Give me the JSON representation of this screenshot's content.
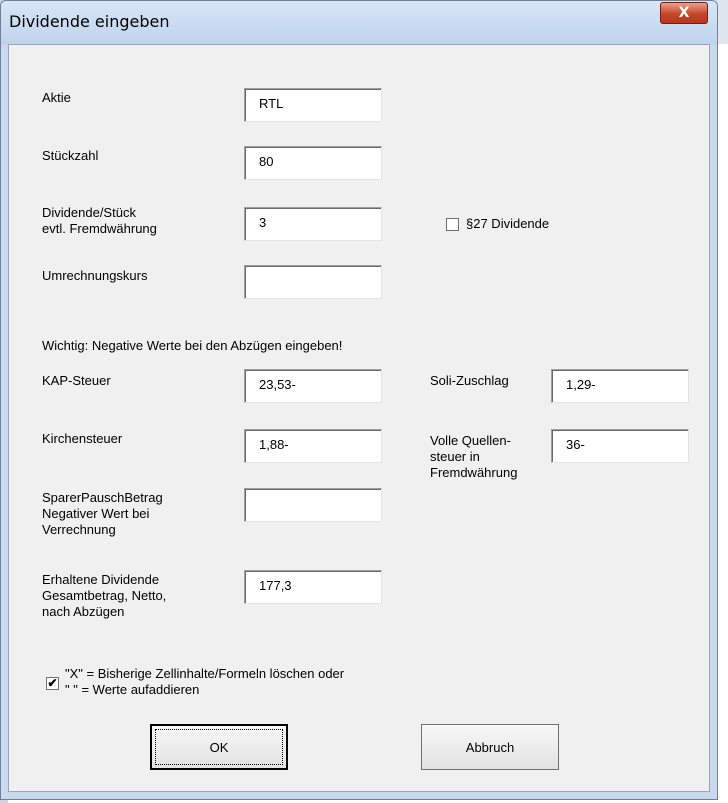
{
  "dialog": {
    "title": "Dividende eingeben",
    "close_symbol": "X"
  },
  "fields": {
    "aktie": {
      "label": "Aktie",
      "value": "RTL"
    },
    "stueckzahl": {
      "label": "Stückzahl",
      "value": "80"
    },
    "dividende": {
      "label": "Dividende/Stück\nevtl. Fremdwährung",
      "value": "3"
    },
    "umrechnung": {
      "label": "Umrechnungskurs",
      "value": ""
    },
    "kap_steuer": {
      "label": "KAP-Steuer",
      "value": "23,53-"
    },
    "soli": {
      "label": "Soli-Zuschlag",
      "value": "1,29-"
    },
    "kirchensteuer": {
      "label": "Kirchensteuer",
      "value": "1,88-"
    },
    "quellensteuer": {
      "label": "Volle  Quellen-\nsteuer in\nFremdwährung",
      "value": "36-"
    },
    "sparer": {
      "label": "SparerPauschBetrag\nNegativer Wert bei\nVerrechnung",
      "value": ""
    },
    "erhalten": {
      "label": "Erhaltene Dividende\nGesamtbetrag, Netto,\nnach Abzügen",
      "value": "177,3"
    }
  },
  "paragraph27": {
    "label": "§27 Dividende",
    "checked": false
  },
  "hint": "Wichtig:  Negative Werte bei den Abzügen eingeben!",
  "clear_option": {
    "label": "\"X\" = Bisherige Zellinhalte/Formeln löschen  oder\n\" \" = Werte aufaddieren",
    "checked": true,
    "check_glyph": "✔"
  },
  "buttons": {
    "ok": "OK",
    "cancel": "Abbruch"
  }
}
